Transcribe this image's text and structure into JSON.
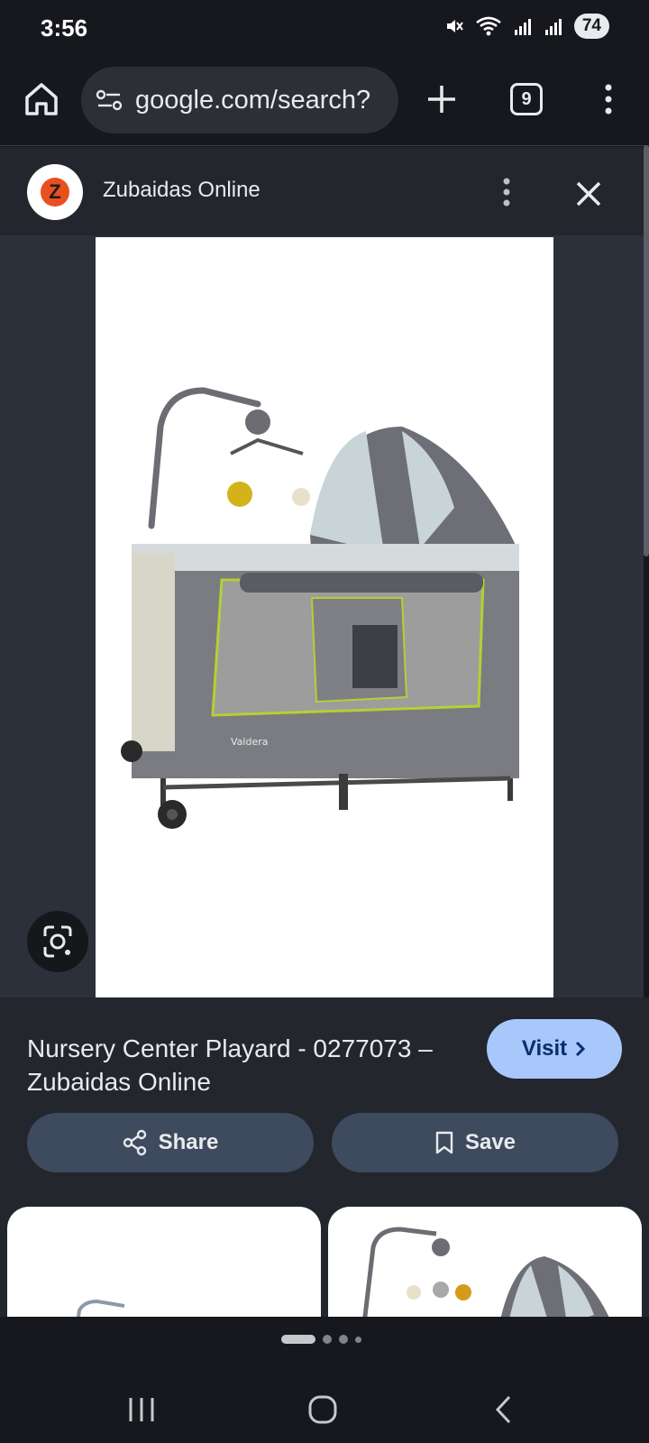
{
  "status": {
    "time": "3:56",
    "battery": "74"
  },
  "browser": {
    "url": "google.com/search?",
    "tab_count": "9"
  },
  "site": {
    "name": "Zubaidas Online",
    "logo_letter": "Z"
  },
  "image": {
    "brand_text": "Valdera"
  },
  "result": {
    "title": "Nursery Center Playard - 0277073 – Zubaidas Online",
    "visit_label": "Visit",
    "share_label": "Share",
    "save_label": "Save"
  },
  "colors": {
    "visit_bg": "#a8c7fa",
    "action_bg": "#3e4a5d",
    "logo_accent": "#e8501f"
  },
  "icons": [
    "home-icon",
    "url-settings-icon",
    "plus-icon",
    "tabs-icon",
    "more-vert-icon",
    "close-icon",
    "lens-icon",
    "share-icon",
    "bookmark-icon",
    "chevron-right-icon",
    "recents-icon",
    "home-nav-icon",
    "back-icon"
  ]
}
